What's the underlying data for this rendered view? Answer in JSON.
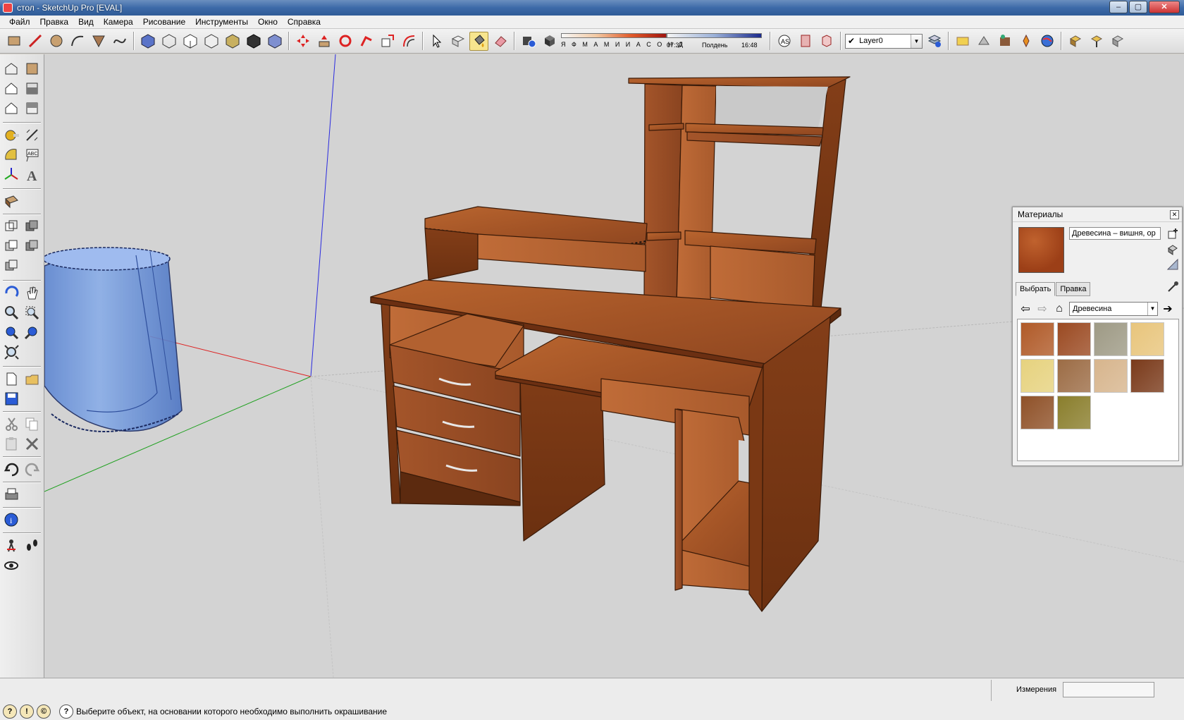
{
  "window": {
    "title": "стол - SketchUp Pro [EVAL]",
    "buttons": {
      "minimize": "–",
      "maximize": "▢",
      "close": "✕"
    }
  },
  "menu": [
    "Файл",
    "Правка",
    "Вид",
    "Камера",
    "Рисование",
    "Инструменты",
    "Окно",
    "Справка"
  ],
  "shadows": {
    "months": "Я Ф М А М И И А С О Н Д",
    "time_start": "07:37",
    "noon": "Полдень",
    "time_end": "16:48"
  },
  "layer": {
    "name": "Layer0",
    "checked": true
  },
  "materials_panel": {
    "title": "Материалы",
    "material_name": "Древесина – вишня, ор",
    "tabs": [
      "Выбрать",
      "Правка"
    ],
    "active_tab": "Выбрать",
    "library": "Древесина",
    "swatch_colors": [
      "#b05a28",
      "#9b4a22",
      "#9e9a85",
      "#e8c57c",
      "#e6d27e",
      "#9c6c45",
      "#d7b58d",
      "#7a3a1a",
      "#8f5128",
      "#8a7e2c"
    ]
  },
  "status": {
    "measurements_label": "Измерения",
    "measurements_value": "",
    "message": "Выберите объект, на основании которого необходимо выполнить окрашивание"
  },
  "colors": {
    "wood_top": "#a8582a",
    "wood_front": "#8e4720",
    "wood_side": "#743514",
    "cylinder": "#6d94d9",
    "background": "#d3d3d3"
  }
}
